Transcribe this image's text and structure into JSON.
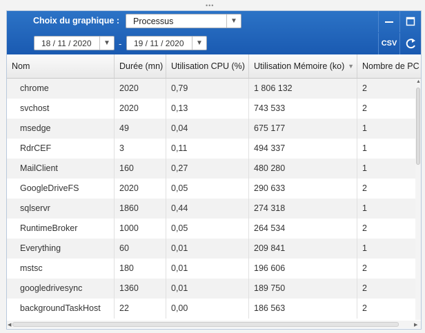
{
  "toolbar": {
    "chart_choice_label": "Choix du graphique :",
    "chart_choice_value": "Processus",
    "date_from": "18 / 11 / 2020",
    "date_separator": "-",
    "date_to": "19 / 11 / 2020",
    "csv_label": "CSV",
    "minimize_icon": "minimize-icon",
    "maximize_icon": "maximize-icon",
    "refresh_icon": "refresh-icon"
  },
  "table": {
    "columns": [
      "Nom",
      "Durée (mn)",
      "Utilisation CPU (%)",
      "Utilisation Mémoire (ko)",
      "Nombre de PC"
    ],
    "rows": [
      [
        "chrome",
        "2020",
        "0,79",
        "1 806 132",
        "2"
      ],
      [
        "svchost",
        "2020",
        "0,13",
        "743 533",
        "2"
      ],
      [
        "msedge",
        "49",
        "0,04",
        "675 177",
        "1"
      ],
      [
        "RdrCEF",
        "3",
        "0,11",
        "494 337",
        "1"
      ],
      [
        "MailClient",
        "160",
        "0,27",
        "480 280",
        "1"
      ],
      [
        "GoogleDriveFS",
        "2020",
        "0,05",
        "290 633",
        "2"
      ],
      [
        "sqlservr",
        "1860",
        "0,44",
        "274 318",
        "1"
      ],
      [
        "RuntimeBroker",
        "1000",
        "0,05",
        "264 534",
        "2"
      ],
      [
        "Everything",
        "60",
        "0,01",
        "209 841",
        "1"
      ],
      [
        "mstsc",
        "180",
        "0,01",
        "196 606",
        "2"
      ],
      [
        "googledrivesync",
        "1360",
        "0,01",
        "189 750",
        "2"
      ],
      [
        "backgroundTaskHost",
        "22",
        "0,00",
        "186 563",
        "2"
      ]
    ],
    "sorted_column": "Utilisation Mémoire (ko)",
    "sort_direction": "descending"
  },
  "colors": {
    "header_blue": "#1f63b9",
    "row_alt": "#f2f2f2"
  }
}
